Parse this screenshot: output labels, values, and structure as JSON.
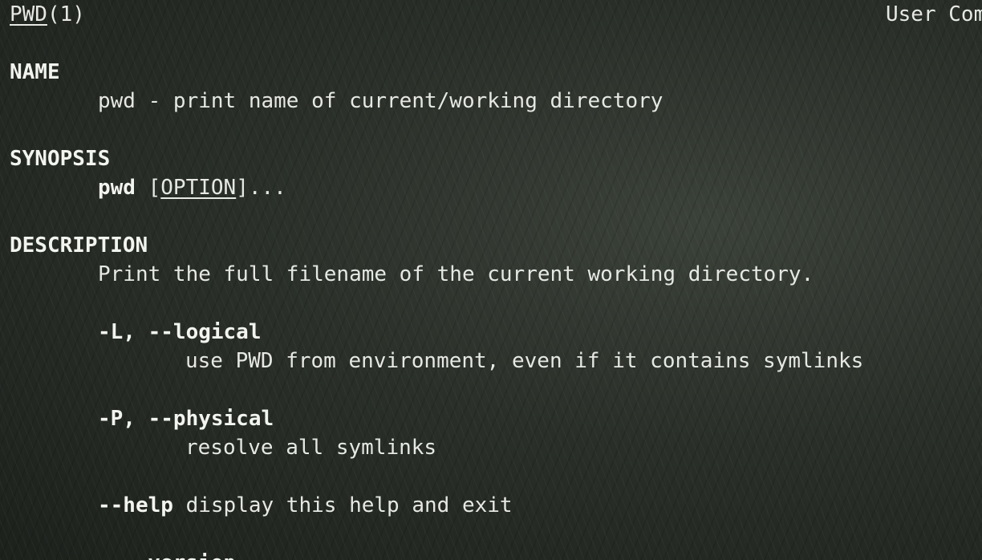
{
  "header": {
    "command": "PWD",
    "section": "(1)",
    "right": "User Com"
  },
  "name": {
    "heading": "NAME",
    "text": "pwd - print name of current/working directory"
  },
  "synopsis": {
    "heading": "SYNOPSIS",
    "command": "pwd",
    "open_bracket": " [",
    "option": "OPTION",
    "close": "]..."
  },
  "description": {
    "heading": "DESCRIPTION",
    "text": "Print the full filename of the current working directory.",
    "options": [
      {
        "flag": "-L, --logical",
        "desc": "use PWD from environment, even if it contains symlinks"
      },
      {
        "flag": "-P, --physical",
        "desc": "resolve all symlinks"
      },
      {
        "flag": "--help",
        "desc": " display this help and exit"
      },
      {
        "flag": "--version"
      }
    ]
  }
}
